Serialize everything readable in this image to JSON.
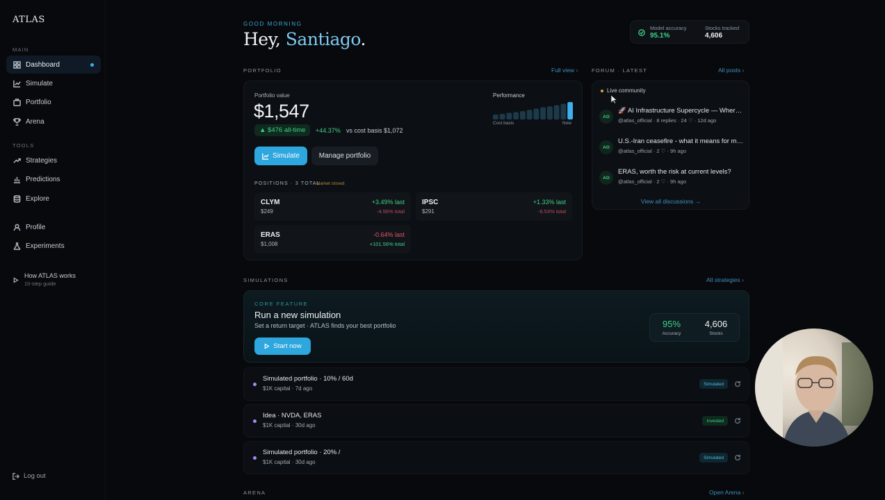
{
  "app": {
    "logo": "ATLAS"
  },
  "sidebar": {
    "main_label": "MAIN",
    "tools_label": "TOOLS",
    "items": [
      {
        "label": "Dashboard",
        "icon": "grid-icon"
      },
      {
        "label": "Simulate",
        "icon": "line-chart-icon"
      },
      {
        "label": "Portfolio",
        "icon": "briefcase-icon"
      },
      {
        "label": "Arena",
        "icon": "trophy-icon"
      },
      {
        "label": "Strategies",
        "icon": "trend-icon"
      },
      {
        "label": "Predictions",
        "icon": "bar-chart-icon"
      },
      {
        "label": "Explore",
        "icon": "database-icon"
      },
      {
        "label": "Profile",
        "icon": "user-icon"
      },
      {
        "label": "Experiments",
        "icon": "flask-icon"
      }
    ],
    "help_title": "How ATLAS works",
    "help_sub": "10-step guide",
    "logout": "Log out"
  },
  "header": {
    "greeting": "GOOD MORNING",
    "hey": "Hey, ",
    "name": "Santiago",
    "period": ".",
    "accuracy_label": "Model accuracy",
    "accuracy_value": "95.1%",
    "stocks_label": "Stocks tracked",
    "stocks_value": "4,606"
  },
  "portfolio": {
    "section": "PORTFOLIO",
    "link": "Full view",
    "value_label": "Portfolio value",
    "value": "$1,547",
    "gain": "▲ $476 all-time",
    "pct": "+44.37%",
    "vs": "vs cost basis $1,072",
    "simulate_btn": "Simulate",
    "manage_btn": "Manage portfolio",
    "perf_label": "Performance",
    "perf_start": "Cost basis",
    "perf_end": "Now",
    "perf_bars": [
      0.28,
      0.32,
      0.38,
      0.42,
      0.48,
      0.55,
      0.62,
      0.7,
      0.75,
      0.82,
      0.9,
      1.0
    ],
    "positions_title": "POSITIONS · 3 TOTAL",
    "market": "Market closed",
    "positions": [
      {
        "ticker": "CLYM",
        "price": "$249",
        "last": "+3.49% last",
        "total": "-4.56% total"
      },
      {
        "ticker": "IPSC",
        "price": "$291",
        "last": "+1.33% last",
        "total": "-6.53% total"
      },
      {
        "ticker": "ERAS",
        "price": "$1,008",
        "last": "-0.64% last",
        "total": "+101.56% total"
      }
    ]
  },
  "forum": {
    "section": "FORUM · LATEST",
    "link": "All posts",
    "live": "Live community",
    "posts": [
      {
        "avatar": "AO",
        "title": "🚀 AI Infrastructure Supercycle — Where the Smart Money Is Going",
        "meta": "@atlas_official · 8 replies · 24 ♡ · 12d ago"
      },
      {
        "avatar": "AO",
        "title": "U.S.-Iran ceasefire - what it means for markets",
        "meta": "@atlas_official · 2 ♡ · 9h ago"
      },
      {
        "avatar": "AO",
        "title": "ERAS, worth the risk at current levels?",
        "meta": "@atlas_official · 2 ♡ · 9h ago"
      }
    ],
    "view_all": "View all discussions →"
  },
  "simulations": {
    "section": "SIMULATIONS",
    "link": "All strategies",
    "core": "CORE FEATURE",
    "title": "Run a new simulation",
    "subtitle": "Set a return target · ATLAS finds your best portfolio",
    "start": "Start now",
    "kpi_acc": "95%",
    "kpi_acc_label": "Accuracy",
    "kpi_stocks": "4,606",
    "kpi_stocks_label": "Stocks",
    "rows": [
      {
        "title": "Simulated portfolio · 10% / 60d",
        "meta": "$1K capital · 7d ago",
        "badge": "Simulated"
      },
      {
        "title": "Idea · NVDA, ERAS",
        "meta": "$1K capital · 30d ago",
        "badge": "Invested"
      },
      {
        "title": "Simulated portfolio · 20% /",
        "meta": "$1K capital · 30d ago",
        "badge": "Simulated"
      }
    ]
  },
  "arena": {
    "section": "ARENA",
    "link": "Open Arena"
  },
  "colors": {
    "accent": "#2ea6de",
    "positive": "#3fd08a",
    "negative": "#e0556a",
    "background": "#07090c"
  }
}
